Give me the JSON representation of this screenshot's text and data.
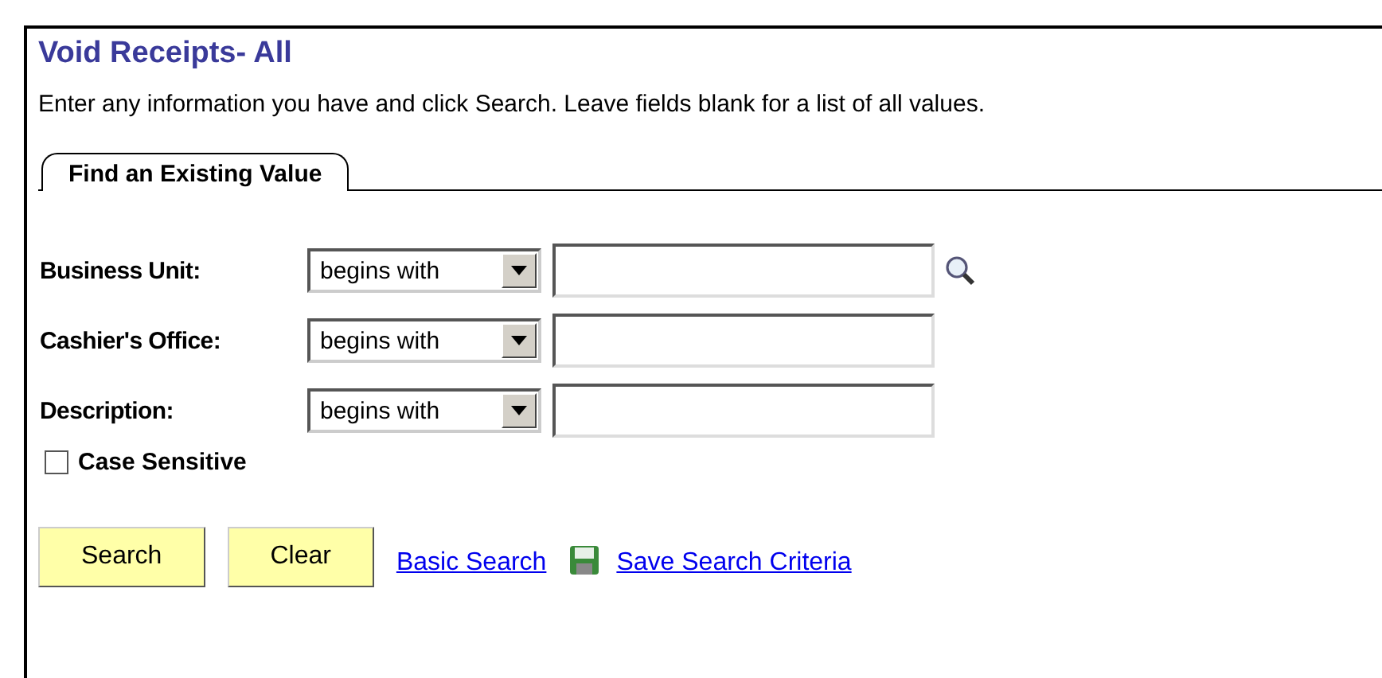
{
  "page": {
    "title": "Void Receipts- All",
    "instructions": "Enter any information you have and click Search. Leave fields blank for a list of all values."
  },
  "tabs": [
    {
      "label": "Find an Existing Value",
      "selected": true
    }
  ],
  "fields": [
    {
      "label": "Business Unit:",
      "operator": "begins with",
      "lookup": true
    },
    {
      "label": "Cashier's Office:",
      "operator": "begins with",
      "lookup": false
    },
    {
      "label": "Description:",
      "operator": "begins with",
      "lookup": false
    }
  ],
  "case_sensitive": {
    "label": "Case Sensitive",
    "checked": false
  },
  "buttons": [
    "Search",
    "Clear"
  ],
  "links": [
    {
      "label": "Basic Search",
      "icon": false
    },
    {
      "label": "Save Search Criteria",
      "icon": true
    }
  ]
}
